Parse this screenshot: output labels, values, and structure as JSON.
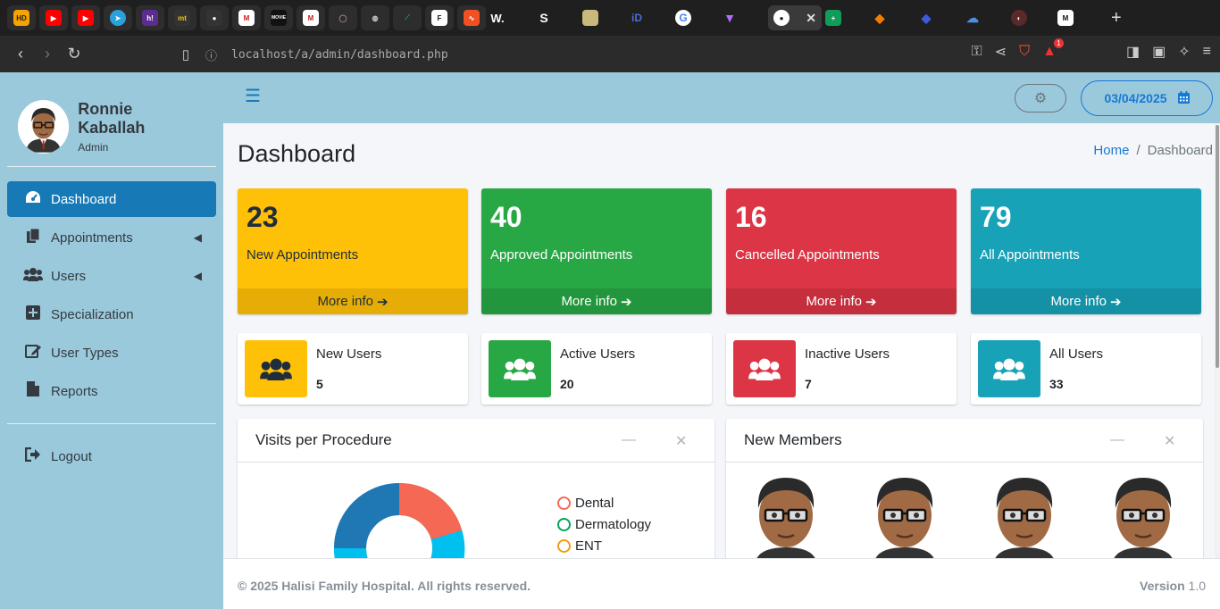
{
  "browser": {
    "tabs": [
      {
        "icon": "hd-icon",
        "text": "HD",
        "color": "#f4a300"
      },
      {
        "icon": "youtube-icon",
        "text": "▶",
        "color": "#ff0000"
      },
      {
        "icon": "youtube-icon",
        "text": "▶",
        "color": "#ff0000"
      },
      {
        "icon": "telegram-icon",
        "text": "➤",
        "color": "#2aa1da"
      },
      {
        "icon": "hashnode-icon",
        "text": "h!",
        "color": "#5c2d91"
      },
      {
        "icon": "mt-icon",
        "text": "mt",
        "color": "#333"
      },
      {
        "icon": "github-icon",
        "text": "●",
        "color": "#333"
      },
      {
        "icon": "gmail-icon",
        "text": "M",
        "color": "#c5221f"
      },
      {
        "icon": "movie-icon",
        "text": "MOVIE",
        "color": "#b00"
      },
      {
        "icon": "gmail-icon",
        "text": "M",
        "color": "#c5221f"
      },
      {
        "icon": "circle-icon",
        "text": "◯",
        "color": "#663"
      },
      {
        "icon": "globe-icon",
        "text": "◍",
        "color": "#555"
      },
      {
        "icon": "pen-icon",
        "text": "⟋",
        "color": "#0a7"
      },
      {
        "icon": "framer-icon",
        "text": "F",
        "color": "#333"
      },
      {
        "icon": "chart-icon",
        "text": "∿",
        "color": "#f25022"
      }
    ],
    "url": "localhost/a/admin/dashboard.php",
    "badge_count": "1"
  },
  "sidebar": {
    "user_name": "Ronnie Kaballah",
    "user_role": "Admin",
    "items": [
      {
        "label": "Dashboard",
        "icon": "tachometer-icon"
      },
      {
        "label": "Appointments",
        "icon": "copy-icon"
      },
      {
        "label": "Users",
        "icon": "users-icon"
      },
      {
        "label": "Specialization",
        "icon": "plus-square-icon"
      },
      {
        "label": "User Types",
        "icon": "edit-icon"
      },
      {
        "label": "Reports",
        "icon": "file-icon"
      }
    ],
    "logout": "Logout"
  },
  "header": {
    "date": "03/04/2025"
  },
  "page": {
    "title": "Dashboard",
    "breadcrumb_home": "Home",
    "breadcrumb_sep": "/",
    "breadcrumb_current": "Dashboard"
  },
  "stats": [
    {
      "value": "23",
      "label": "New Appointments",
      "more": "More info"
    },
    {
      "value": "40",
      "label": "Approved Appointments",
      "more": "More info"
    },
    {
      "value": "16",
      "label": "Cancelled Appointments",
      "more": "More info"
    },
    {
      "value": "79",
      "label": "All Appointments",
      "more": "More info"
    }
  ],
  "user_stats": [
    {
      "label": "New Users",
      "value": "5"
    },
    {
      "label": "Active Users",
      "value": "20"
    },
    {
      "label": "Inactive Users",
      "value": "7"
    },
    {
      "label": "All Users",
      "value": "33"
    }
  ],
  "procedures_card": {
    "title": "Visits per Procedure",
    "legend": [
      {
        "label": "Dental",
        "color": "#f56954"
      },
      {
        "label": "Dermatology",
        "color": "#00a65a"
      },
      {
        "label": "ENT",
        "color": "#f39c12"
      }
    ]
  },
  "members_card": {
    "title": "New Members"
  },
  "footer": {
    "copyright": "© 2025 Halisi Family Hospital. All rights reserved.",
    "version_label": "Version",
    "version": "1.0"
  },
  "colors": {
    "sidebar_bg": "#9ac9dc",
    "accent": "#1779b6",
    "yellow": "#ffc107",
    "green": "#28a745",
    "red": "#dc3545",
    "teal": "#17a2b8"
  }
}
